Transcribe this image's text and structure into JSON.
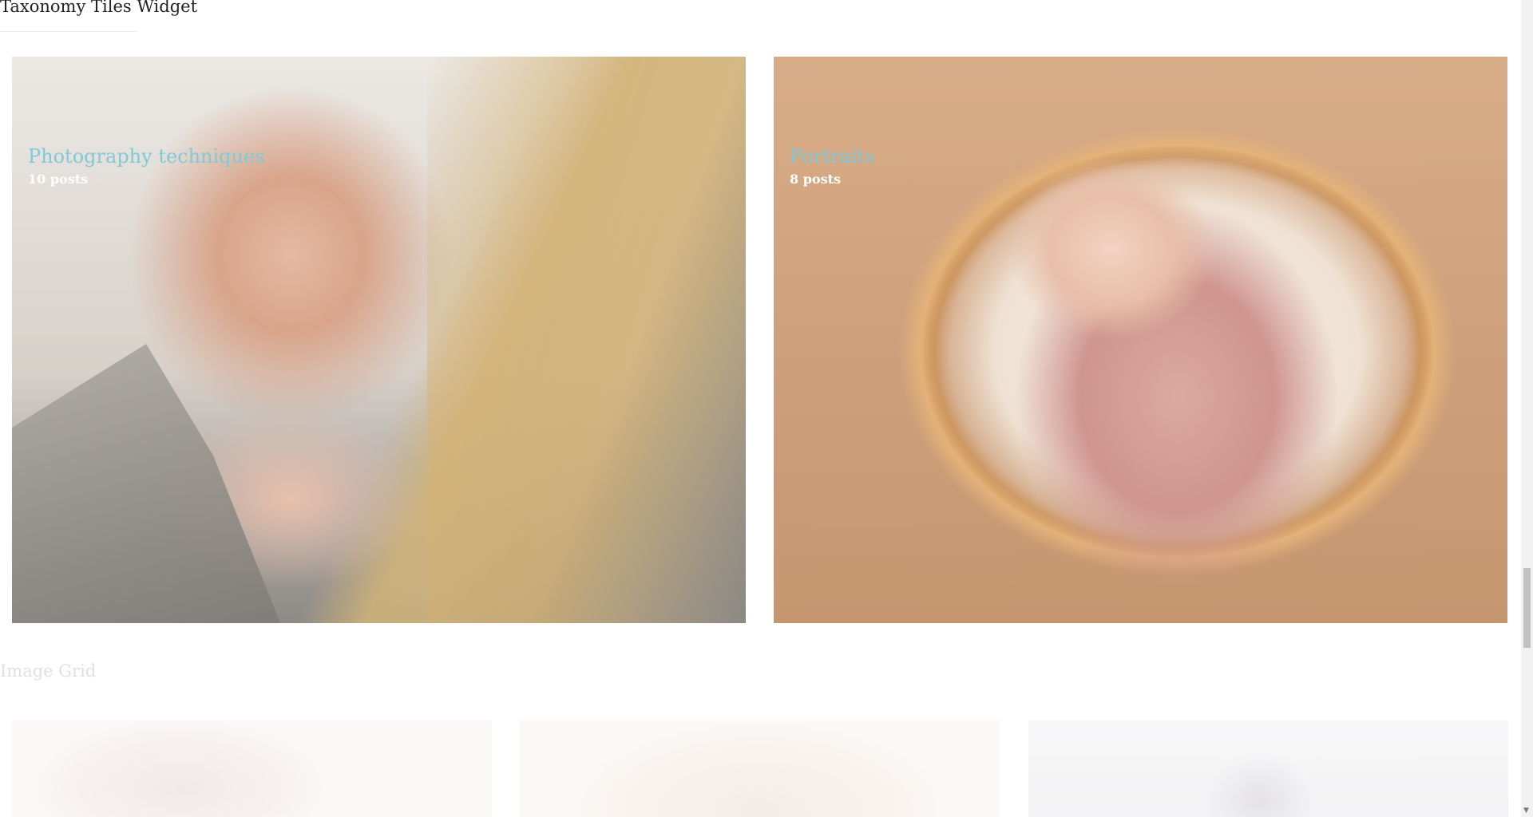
{
  "widget": {
    "title": "Taxonomy Tiles Widget",
    "tiles": [
      {
        "name": "Photography techniques",
        "count": "10 posts"
      },
      {
        "name": "Portraits",
        "count": "8 posts"
      }
    ]
  },
  "image_grid": {
    "title": "Image Grid"
  },
  "colors": {
    "tile_name": "#7ecad9",
    "tile_count": "#ffffff",
    "heading": "#222222"
  }
}
